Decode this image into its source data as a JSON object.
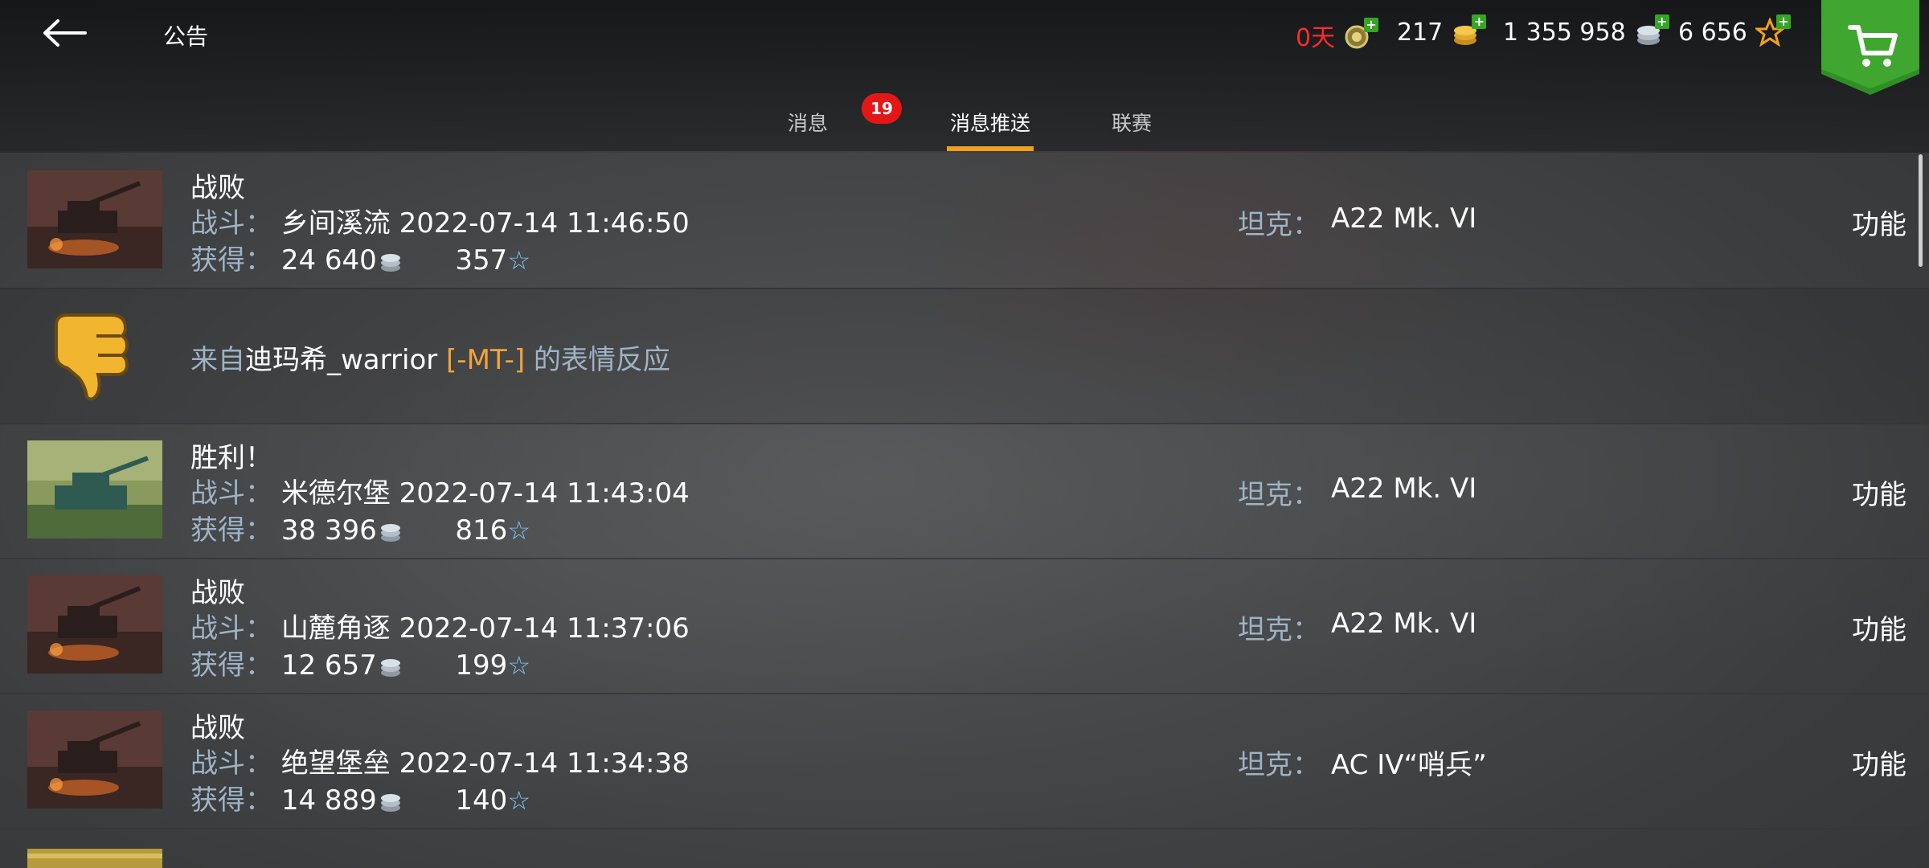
{
  "header": {
    "title": "公告",
    "currencies": [
      {
        "value": "0天",
        "icon": "premium-days-icon"
      },
      {
        "value": "217",
        "icon": "gold-coins-icon"
      },
      {
        "value": "1 355 958",
        "icon": "silver-coins-icon"
      },
      {
        "value": "6 656",
        "icon": "free-xp-star-icon"
      }
    ],
    "shop_icon": "shopping-cart-icon"
  },
  "tabs": [
    {
      "label": "消息",
      "badge": "19"
    },
    {
      "label": "消息推送",
      "active": true
    },
    {
      "label": "联赛"
    }
  ],
  "labels": {
    "battle": "战斗：",
    "earned": "获得：",
    "tank": "坦克：",
    "function": "功能"
  },
  "messages": [
    {
      "type": "battle",
      "result": "战败",
      "map": "乡间溪流",
      "datetime": "2022-07-14 11:46:50",
      "credits": "24 640",
      "xp": "357",
      "tank": "A22 Mk. VI"
    },
    {
      "type": "reaction",
      "prefix": "来自",
      "player": "迪玛希_warrior",
      "clan": "[-MT-]",
      "suffix": "的表情反应"
    },
    {
      "type": "battle",
      "result": "胜利！",
      "map": "米德尔堡",
      "datetime": "2022-07-14 11:43:04",
      "credits": "38 396",
      "xp": "816",
      "tank": "A22 Mk. VI"
    },
    {
      "type": "battle",
      "result": "战败",
      "map": "山麓角逐",
      "datetime": "2022-07-14 11:37:06",
      "credits": "12 657",
      "xp": "199",
      "tank": "A22 Mk. VI"
    },
    {
      "type": "battle",
      "result": "战败",
      "map": "绝望堡垒",
      "datetime": "2022-07-14 11:34:38",
      "credits": "14 889",
      "xp": "140",
      "tank": "AC IV“哨兵”"
    }
  ],
  "colors": {
    "accent": "#f0a01c",
    "badge": "#e41717",
    "label_blue": "#9fb3c6",
    "clan_orange": "#f2a43a",
    "premium_red": "#ff2a2a"
  }
}
